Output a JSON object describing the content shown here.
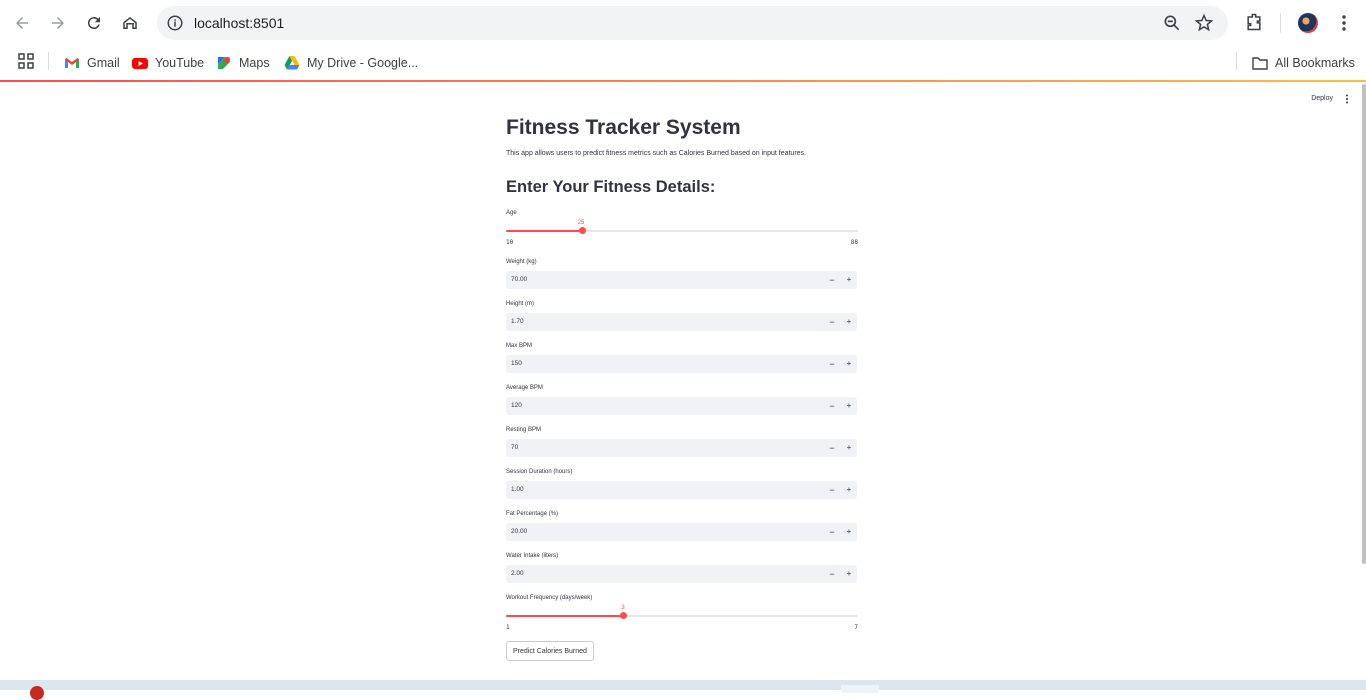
{
  "browser": {
    "url": "localhost:8501",
    "bookmarks": [
      {
        "label": "Gmail",
        "icon": "gmail-icon"
      },
      {
        "label": "YouTube",
        "icon": "youtube-icon"
      },
      {
        "label": "Maps",
        "icon": "maps-icon"
      },
      {
        "label": "My Drive - Google...",
        "icon": "drive-icon"
      }
    ],
    "all_bookmarks": "All Bookmarks"
  },
  "app": {
    "deploy": "Deploy",
    "title": "Fitness Tracker System",
    "description": "This app allows users to predict fitness metrics such as Calories Burned based on input features.",
    "subheader": "Enter Your Fitness Details:",
    "accent_color": "#ff4b4b",
    "age": {
      "label": "Age",
      "value": "25",
      "min": "10",
      "max": "88",
      "fraction": 0.2179
    },
    "inputs": [
      {
        "label": "Weight (kg)",
        "value": "70.00"
      },
      {
        "label": "Height (m)",
        "value": "1.70"
      },
      {
        "label": "Max BPM",
        "value": "150"
      },
      {
        "label": "Average BPM",
        "value": "120"
      },
      {
        "label": "Resting BPM",
        "value": "70"
      },
      {
        "label": "Session Duration (hours)",
        "value": "1.00"
      },
      {
        "label": "Fat Percentage (%)",
        "value": "20.00"
      },
      {
        "label": "Water Intake (liters)",
        "value": "2.00"
      }
    ],
    "stepper": {
      "minus": "−",
      "plus": "+"
    },
    "workout": {
      "label": "Workout Frequency (days/week)",
      "value": "3",
      "min": "1",
      "max": "7",
      "fraction": 0.3333
    },
    "predict_button": "Predict Calories Burned"
  }
}
